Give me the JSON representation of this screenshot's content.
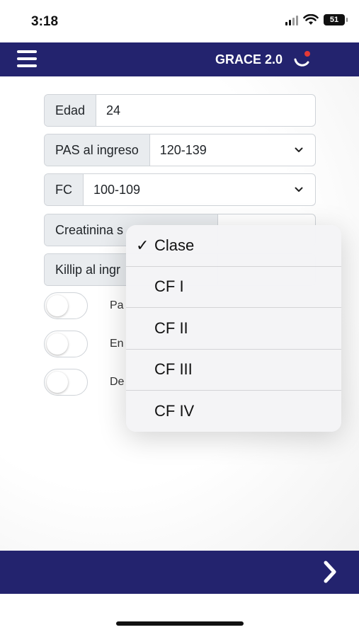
{
  "status_bar": {
    "time": "3:18",
    "battery": "51"
  },
  "header": {
    "title": "GRACE 2.0",
    "menu_icon": "hamburger-menu-icon",
    "logo_icon": "grace-logo-icon",
    "background": "#23236e"
  },
  "form": {
    "edad": {
      "label": "Edad",
      "value": "24"
    },
    "pas": {
      "label": "PAS al ingreso",
      "value": "120-139"
    },
    "fc": {
      "label": "FC",
      "value": "100-109"
    },
    "creatinina": {
      "label": "Creatinina s"
    },
    "killip": {
      "label": "Killip al ingr"
    },
    "toggles": [
      {
        "label": "Pa",
        "checked": false
      },
      {
        "label": "En",
        "checked": false
      },
      {
        "label": "De",
        "checked": false
      }
    ]
  },
  "dropdown_menu": {
    "selected": "Clase",
    "options": [
      "Clase",
      "CF I",
      "CF II",
      "CF III",
      "CF IV"
    ]
  },
  "footer": {
    "next_icon": "chevron-right-icon"
  },
  "colors": {
    "brand": "#23236e",
    "logo_accent": "#e53935"
  }
}
